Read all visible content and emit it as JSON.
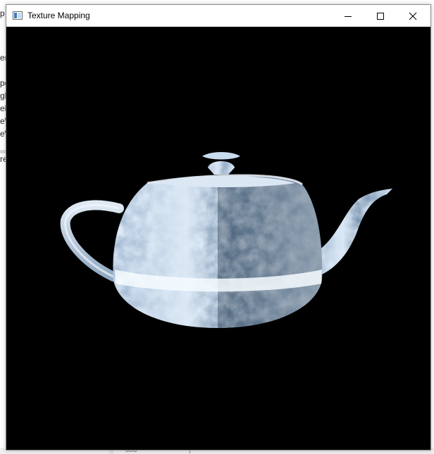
{
  "window": {
    "title": "Texture Mapping",
    "icon": "application-window-icon",
    "controls": [
      "minimize-icon",
      "maximize-icon",
      "close-icon"
    ]
  },
  "background_app": {
    "left_fragments": [
      "p",
      "er",
      "pe",
      "gl",
      "el",
      "e\\",
      "e\\",
      "re"
    ],
    "bottom_number": "383",
    "bottom_text": "}"
  },
  "scene": {
    "subject": "teapot",
    "background_color": "#000000",
    "tint_color": "#bcd3ea",
    "highlight_color": "#ffffff"
  }
}
